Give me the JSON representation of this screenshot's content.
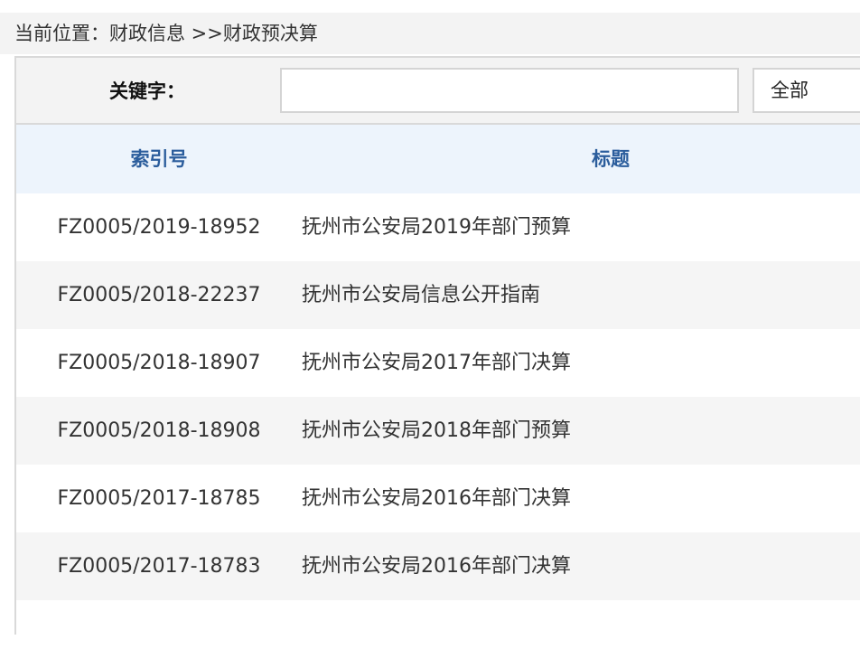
{
  "breadcrumb": {
    "text": "当前位置：财政信息 >>财政预决算"
  },
  "search": {
    "label": "关键字：",
    "value": "",
    "placeholder": "",
    "scope_selected": "全部"
  },
  "table": {
    "headers": {
      "index": "索引号",
      "title": "标题"
    },
    "rows": [
      {
        "index": "FZ0005/2019-18952",
        "title": "抚州市公安局2019年部门预算"
      },
      {
        "index": "FZ0005/2018-22237",
        "title": "抚州市公安局信息公开指南"
      },
      {
        "index": "FZ0005/2018-18907",
        "title": "抚州市公安局2017年部门决算"
      },
      {
        "index": "FZ0005/2018-18908",
        "title": "抚州市公安局2018年部门预算"
      },
      {
        "index": "FZ0005/2017-18785",
        "title": "抚州市公安局2016年部门决算"
      },
      {
        "index": "FZ0005/2017-18783",
        "title": "抚州市公安局2016年部门决算"
      },
      {
        "index": "",
        "title": ""
      }
    ]
  },
  "colors": {
    "header_text": "#2b5d9c",
    "header_bg": "#edf4fc",
    "alt_row_bg": "#f5f5f5",
    "search_bg": "#f3f3f3"
  }
}
